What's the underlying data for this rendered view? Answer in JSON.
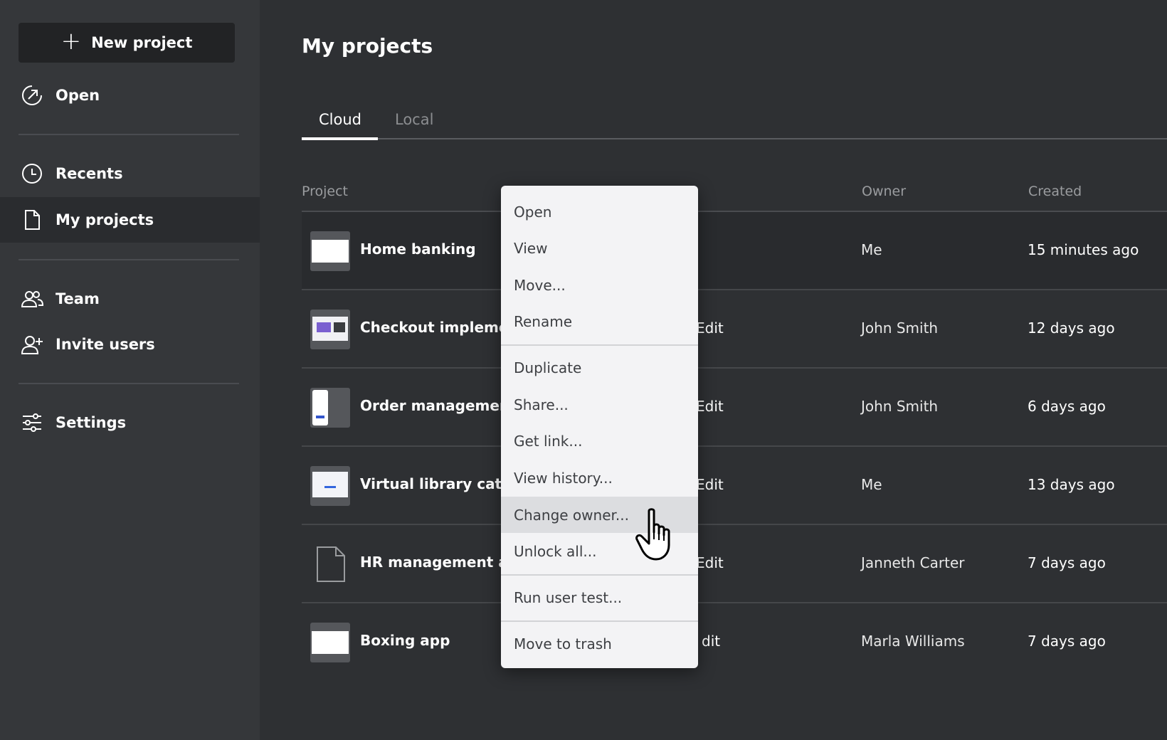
{
  "sidebar": {
    "new_project_label": "New project",
    "items": [
      {
        "label": "Open",
        "icon": "open-icon"
      },
      {
        "label": "Recents",
        "icon": "clock-icon"
      },
      {
        "label": "My projects",
        "icon": "document-icon",
        "active": true
      },
      {
        "label": "Team",
        "icon": "team-icon"
      },
      {
        "label": "Invite users",
        "icon": "invite-user-icon"
      },
      {
        "label": "Settings",
        "icon": "sliders-icon"
      }
    ]
  },
  "main": {
    "title": "My projects",
    "tabs": [
      {
        "label": "Cloud",
        "active": true
      },
      {
        "label": "Local",
        "active": false
      }
    ],
    "columns": {
      "project": "Project",
      "owner": "Owner",
      "created": "Created"
    },
    "rows": [
      {
        "name": "Home banking",
        "access": "",
        "owner": "Me",
        "created": "15 minutes ago",
        "thumbnail": "blank"
      },
      {
        "name": "Checkout implemen",
        "access": "Edit",
        "owner": "John Smith",
        "created": "12 days ago",
        "thumbnail": "web"
      },
      {
        "name": "Order management",
        "access": "Edit",
        "owner": "John Smith",
        "created": "6 days ago",
        "thumbnail": "mobile"
      },
      {
        "name": "Virtual library catalo",
        "access": "Edit",
        "owner": "Me",
        "created": "13 days ago",
        "thumbnail": "form"
      },
      {
        "name": "HR management ap",
        "access": "Edit",
        "owner": "Janneth Carter",
        "created": "7 days ago",
        "thumbnail": "file"
      },
      {
        "name": "Boxing app",
        "access": "dit",
        "owner": "Marla Williams",
        "created": "7 days ago",
        "thumbnail": "blank"
      }
    ]
  },
  "context_menu": {
    "items": [
      "Open",
      "View",
      "Move...",
      "Rename",
      "Duplicate",
      "Share...",
      "Get link...",
      "View history...",
      "Change owner...",
      "Unlock all...",
      "Run user test...",
      "Move to trash"
    ],
    "hovered": "Change owner..."
  },
  "colors": {
    "background": "#2e3033",
    "sidebar": "#35373a",
    "menu": "#f3f3f5",
    "menu_hover": "#dcdde0"
  }
}
